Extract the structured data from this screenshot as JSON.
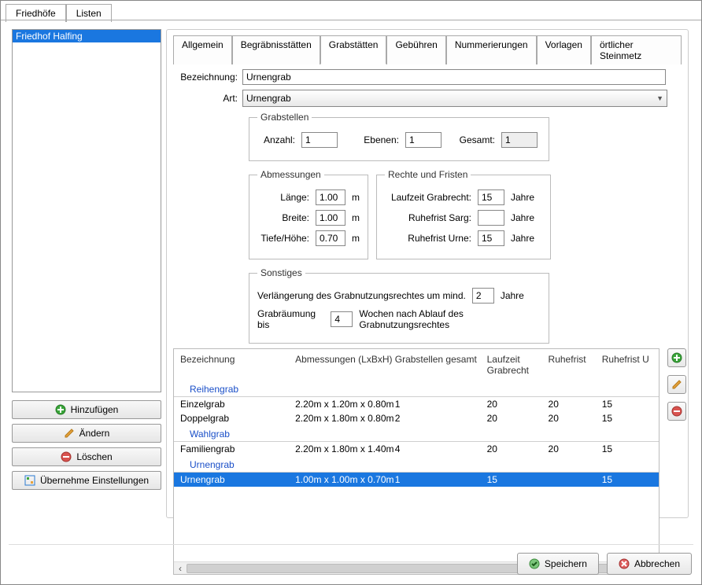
{
  "outerTabs": {
    "friedhofe": "Friedhöfe",
    "listen": "Listen"
  },
  "cemeteryList": {
    "items": [
      "Friedhof Halfing"
    ]
  },
  "leftButtons": {
    "add": "Hinzufügen",
    "edit": "Ändern",
    "del": "Löschen",
    "adopt": "Übernehme Einstellungen"
  },
  "innerTabs": {
    "allgemein": "Allgemein",
    "begraebnis": "Begräbnisstätten",
    "grabstatten": "Grabstätten",
    "gebuehren": "Gebühren",
    "nummerierungen": "Nummerierungen",
    "vorlagen": "Vorlagen",
    "steinmetz": "örtlicher Steinmetz"
  },
  "form": {
    "labels": {
      "bezeichnung": "Bezeichnung:",
      "art": "Art:"
    },
    "bezeichnung": "Urnengrab",
    "art": "Urnengrab"
  },
  "grabstellen": {
    "legend": "Grabstellen",
    "anzahl_lbl": "Anzahl:",
    "anzahl": "1",
    "ebenen_lbl": "Ebenen:",
    "ebenen": "1",
    "gesamt_lbl": "Gesamt:",
    "gesamt": "1"
  },
  "abm": {
    "legend": "Abmessungen",
    "laenge_lbl": "Länge:",
    "laenge": "1.00",
    "breite_lbl": "Breite:",
    "breite": "1.00",
    "tiefe_lbl": "Tiefe/Höhe:",
    "tiefe": "0.70",
    "unit": "m"
  },
  "rechte": {
    "legend": "Rechte und Fristen",
    "grabrecht_lbl": "Laufzeit Grabrecht:",
    "grabrecht": "15",
    "sarg_lbl": "Ruhefrist Sarg:",
    "sarg": "",
    "urne_lbl": "Ruhefrist Urne:",
    "urne": "15",
    "unit": "Jahre"
  },
  "sonst": {
    "legend": "Sonstiges",
    "verlaengerung_pre": "Verlängerung des Grabnutzungsrechtes um mind.",
    "verlaengerung": "2",
    "verlaengerung_post": "Jahre",
    "raeumung_pre": "Grabräumung bis",
    "raeumung": "4",
    "raeumung_post": "Wochen nach Ablauf des Grabnutzungsrechtes"
  },
  "grid": {
    "headers": {
      "bez": "Bezeichnung",
      "abm": "Abmessungen (LxBxH)",
      "gs": "Grabstellen gesamt",
      "lr": "Laufzeit Grabrecht",
      "rf": "Ruhefrist",
      "ru": "Ruhefrist U"
    },
    "groups": {
      "reihengrab": "Reihengrab",
      "wahlgrab": "Wahlgrab",
      "urnengrab": "Urnengrab"
    },
    "rows": {
      "einzel": {
        "bez": "Einzelgrab",
        "abm": "2.20m x 1.20m x 0.80m",
        "gs": "1",
        "lr": "20",
        "rf": "20",
        "ru": "15"
      },
      "doppel": {
        "bez": "Doppelgrab",
        "abm": "2.20m x 1.80m x 0.80m",
        "gs": "2",
        "lr": "20",
        "rf": "20",
        "ru": "15"
      },
      "familien": {
        "bez": "Familiengrab",
        "abm": "2.20m x 1.80m x 1.40m",
        "gs": "4",
        "lr": "20",
        "rf": "20",
        "ru": "15"
      },
      "urnen": {
        "bez": "Urnengrab",
        "abm": "1.00m x 1.00m x 0.70m",
        "gs": "1",
        "lr": "15",
        "rf": "",
        "ru": "15"
      }
    }
  },
  "bottom": {
    "save": "Speichern",
    "cancel": "Abbrechen"
  }
}
